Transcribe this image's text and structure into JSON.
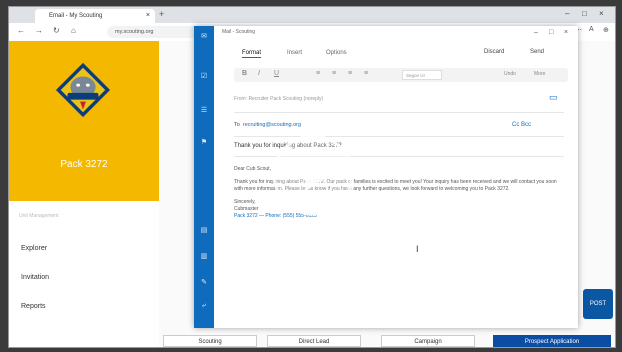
{
  "browser": {
    "tab_title": "Email - My Scouting",
    "tab_close": "×",
    "new_tab": "+",
    "url": "my.scouting.org",
    "nav": {
      "back": "←",
      "forward": "→",
      "reload": "↻",
      "home": "⌂"
    },
    "win_controls": {
      "min": "–",
      "max": "□",
      "close": "×"
    },
    "ext_icons": [
      "⋯",
      "A",
      "⊕"
    ]
  },
  "app": {
    "unit_name": "Pack 3272",
    "sidebar_section": "Unit Management",
    "nav_items": [
      "Explorer",
      "Invitation",
      "Reports"
    ],
    "behind_letters": [
      "L",
      "H",
      "D",
      "D",
      "C",
      "C",
      "d"
    ],
    "post_label": "POST",
    "bottom_tabs": [
      "Scouting",
      "Direct Lead",
      "Campaign",
      "Prospect Application"
    ],
    "colors": {
      "logo_bg": "#f5b800",
      "accent": "#0b4da2"
    }
  },
  "compose": {
    "window_title": "Mail - Scouting",
    "ribbon_tabs": [
      "Format",
      "Insert",
      "Options"
    ],
    "discard": "Discard",
    "send": "Send",
    "toolbar_icons": [
      "B",
      "I",
      "U",
      "≡",
      "≡",
      "≡",
      "≡"
    ],
    "font_name": "Segoe UI",
    "toolbar_right": [
      "Undo",
      "More"
    ],
    "from": "From: Recruiter Pack Scouting (noreply)",
    "to_label": "To",
    "to_recipient": "recruiting@scouting.org",
    "cc_bcc": "Cc Bcc",
    "subject": "Thank you for inquiring about Pack 3272",
    "greeting": "Dear Cub Scout,",
    "body": "Thank you for inquiring about Pack 3272. Our pack of families is excited to meet you! Your inquiry has been received and we will contact you soon with more information. Please let us know if you have any further questions, we look forward to welcoming you to Pack 3272.",
    "signoff": "Sincerely,",
    "signature_name": "Cubmaster",
    "signature_link": "Pack 3272 — Phone: (555) 555-0123",
    "rail_icons": [
      "✉",
      "☑",
      "☰",
      "⚑",
      "◎",
      "▤",
      "▥",
      "✎",
      "⤶",
      "◉"
    ],
    "colors": {
      "rail": "#0f6cbd"
    }
  }
}
